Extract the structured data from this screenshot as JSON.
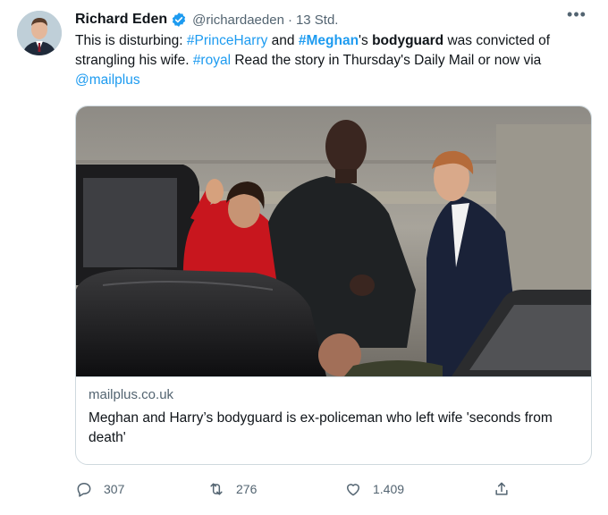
{
  "author": {
    "name": "Richard Eden",
    "handle": "@richardaeden",
    "separator": "·",
    "time": "13 Std."
  },
  "more_label": "•••",
  "tweet": {
    "p1": "This is disturbing: ",
    "tag_harry": "#PrinceHarry",
    "p2": " and ",
    "tag_meghan": "#Meghan",
    "p3": "'s ",
    "bold_word": "bodyguard",
    "p4": " was convicted of strangling his wife. ",
    "tag_royal": "#royal",
    "p5": " Read the story in Thursday's Daily Mail or now via ",
    "mention": "@mailplus"
  },
  "card": {
    "domain": "mailplus.co.uk",
    "title": "Meghan and Harry’s bodyguard is ex-policeman who left wife 'seconds from death'"
  },
  "actions": {
    "replies": "307",
    "retweets": "276",
    "likes": "1.409"
  },
  "colors": {
    "link": "#1d9bf0",
    "text": "#0f1419",
    "muted": "#536471",
    "border": "#cfd9de"
  }
}
